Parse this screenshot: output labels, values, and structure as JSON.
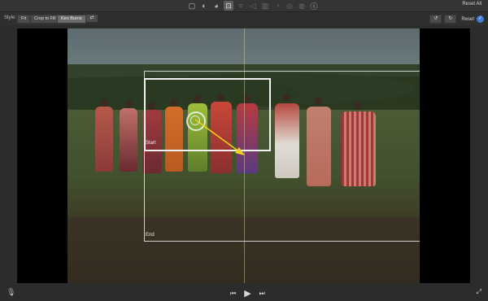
{
  "toolbar": {
    "icons": [
      "crop-icon",
      "color-icon",
      "palette-icon",
      "crop-tool-icon",
      "camera-icon",
      "speaker-icon",
      "graph-icon",
      "speed-icon",
      "filter-icon",
      "stabilize-icon",
      "info-icon"
    ],
    "reset_all_label": "Reset All"
  },
  "style_bar": {
    "style_label": "Style:",
    "options": [
      "Fit",
      "Crop to Fill",
      "Ken Burns"
    ],
    "selected": "Ken Burns",
    "reset_label": "Reset"
  },
  "viewer": {
    "start_label": "Start",
    "end_label": "End"
  },
  "colors": {
    "accent_check": "#3f7fd8",
    "arrow": "#f1d21c"
  },
  "transport": {
    "icons": [
      "skip-back-icon",
      "play-icon",
      "skip-forward-icon"
    ]
  }
}
